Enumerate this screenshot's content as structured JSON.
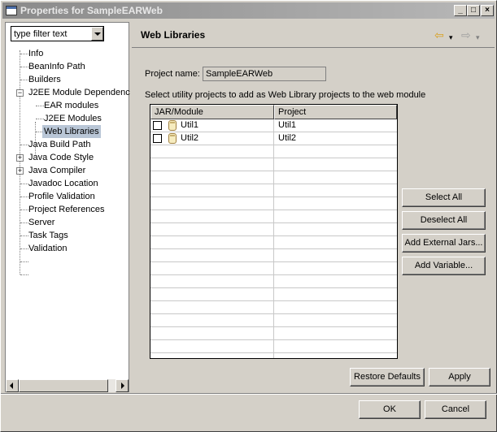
{
  "window": {
    "title": "Properties for SampleEARWeb",
    "minimize": "_",
    "maximize": "□",
    "close": "×"
  },
  "filter": {
    "value": "type filter text"
  },
  "tree": {
    "items": [
      "Info",
      "BeanInfo Path",
      "Builders",
      "J2EE Module Dependenc",
      "EAR modules",
      "J2EE Modules",
      "Web Libraries",
      "Java Build Path",
      "Java Code Style",
      "Java Compiler",
      "Javadoc Location",
      "Profile Validation",
      "Project References",
      "Server",
      "Task Tags",
      "Validation"
    ]
  },
  "page": {
    "title": "Web Libraries",
    "back_arrow": "⇦",
    "forward_arrow": "⇨",
    "dropdown": "▾",
    "project_name_label": "Project name:",
    "project_name_value": "SampleEARWeb",
    "instruction": "Select utility projects to add as Web Library projects to the web module"
  },
  "table": {
    "columns": [
      "JAR/Module",
      "Project"
    ],
    "rows": [
      {
        "jar": "Util1",
        "project": "Util1"
      },
      {
        "jar": "Util2",
        "project": "Util2"
      }
    ]
  },
  "buttons": {
    "select_all": "Select All",
    "deselect_all": "Deselect All",
    "add_external_jars": "Add External Jars...",
    "add_variable": "Add Variable...",
    "restore_defaults": "Restore Defaults",
    "apply": "Apply",
    "ok": "OK",
    "cancel": "Cancel"
  }
}
